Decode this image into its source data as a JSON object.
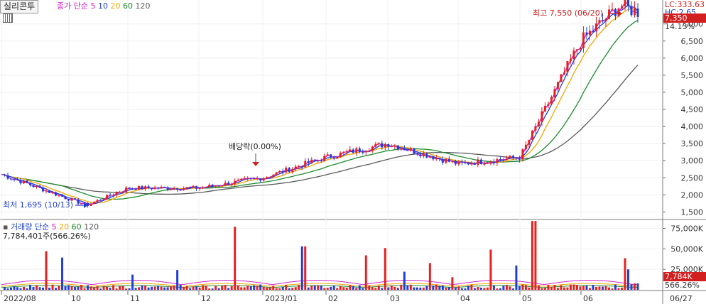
{
  "header": {
    "stock_name": "실리콘투",
    "price_legend": {
      "label": "종가 단순",
      "periods": [
        "5",
        "10",
        "20",
        "60",
        "120"
      ]
    },
    "volume_legend": {
      "label": "거래량 단순",
      "periods": [
        "5",
        "20",
        "60",
        "120"
      ]
    },
    "volume_readout": "7,784,401주(566.26%)",
    "right_readout_lc": "LC:333.63",
    "right_readout_hc": "HC:2.65"
  },
  "price_axis": {
    "ticks": [
      "7,000",
      "6,500",
      "6,000",
      "5,500",
      "5,000",
      "4,500",
      "4,000",
      "3,500",
      "3,000",
      "2,500",
      "2,000",
      "1,500"
    ],
    "current_price": "7,350",
    "current_change": "14.13%"
  },
  "volume_axis": {
    "ticks": [
      "75,000K",
      "50,000K",
      "25,000K"
    ],
    "current_volume": "7,784K",
    "current_pct": "566.26%"
  },
  "x_axis": {
    "labels": [
      "2022/08",
      "10",
      "11",
      "12",
      "2023/01",
      "02",
      "03",
      "04",
      "05",
      "06",
      "06/27"
    ]
  },
  "annotations": {
    "high": "최고 7,550 (06/20)",
    "low": "최저 1,695 (10/13)",
    "ex_div": "배당락(0.00%)"
  },
  "colors": {
    "up": "#e8201f",
    "down": "#1f3fd6",
    "ma5": "#cc22cc",
    "ma10": "#1f3fd6",
    "ma20": "#f0a800",
    "ma60": "#1e8b2e",
    "ma120": "#5a5a5a",
    "accent": "#d21f1f"
  },
  "chart_data": {
    "type": "candlestick",
    "y_range": [
      1300,
      7700
    ],
    "price_anchors": [
      {
        "x": "2022/08",
        "close": 2600
      },
      {
        "x": "10",
        "close": 1880
      },
      {
        "x": "10/13",
        "close": 1695
      },
      {
        "x": "11",
        "close": 2200
      },
      {
        "x": "12",
        "close": 2200
      },
      {
        "x": "2023/01",
        "close": 2500
      },
      {
        "x": "02",
        "close": 3100
      },
      {
        "x": "03",
        "close": 3500
      },
      {
        "x": "04",
        "close": 2900
      },
      {
        "x": "05",
        "close": 3100
      },
      {
        "x": "06",
        "close": 6500
      },
      {
        "x": "06/20",
        "close": 7550
      },
      {
        "x": "06/27",
        "close": 7350
      }
    ],
    "volume_range_k": [
      0,
      85000
    ],
    "volume_tick_values_k": [
      75000,
      50000,
      25000
    ]
  }
}
